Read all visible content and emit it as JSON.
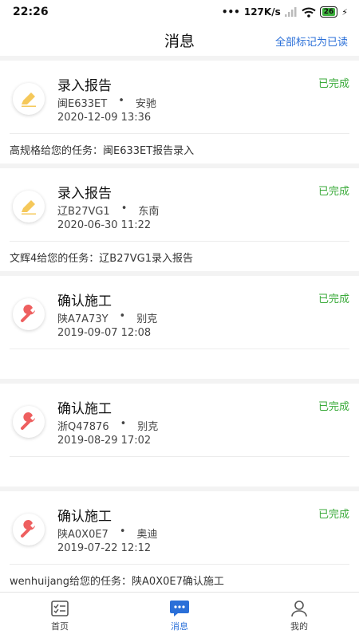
{
  "status_bar": {
    "time": "22:26",
    "network_speed": "127K/s",
    "battery": "26"
  },
  "header": {
    "title": "消息",
    "mark_all_read": "全部标记为已读"
  },
  "messages": [
    {
      "type": "录入报告",
      "icon": "pencil-icon",
      "status": "已完成",
      "plate": "闽E633ET",
      "brand": "安驰",
      "time": "2020-12-09 13:36",
      "description": "高规格给您的任务：闽E633ET报告录入"
    },
    {
      "type": "录入报告",
      "icon": "pencil-icon",
      "status": "已完成",
      "plate": "辽B27VG1",
      "brand": "东南",
      "time": "2020-06-30 11:22",
      "description": "文辉4给您的任务：辽B27VG1录入报告"
    },
    {
      "type": "确认施工",
      "icon": "wrench-icon",
      "status": "已完成",
      "plate": "陕A7A73Y",
      "brand": "别克",
      "time": "2019-09-07 12:08",
      "description": ""
    },
    {
      "type": "确认施工",
      "icon": "wrench-icon",
      "status": "已完成",
      "plate": "浙Q47876",
      "brand": "别克",
      "time": "2019-08-29 17:02",
      "description": ""
    },
    {
      "type": "确认施工",
      "icon": "wrench-icon",
      "status": "已完成",
      "plate": "陕A0X0E7",
      "brand": "奥迪",
      "time": "2019-07-22 12:12",
      "description": "wenhuijang给您的任务：陕A0X0E7确认施工"
    }
  ],
  "tabbar": {
    "home": "首页",
    "messages": "消息",
    "mine": "我的"
  },
  "colors": {
    "accent": "#2a6fd8",
    "status_done": "#3aaa3a",
    "pencil": "#f5c85a",
    "wrench": "#ee5f5f"
  }
}
